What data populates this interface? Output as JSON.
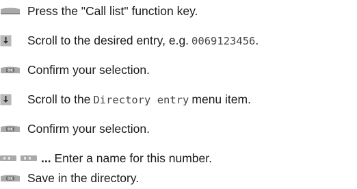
{
  "steps": [
    {
      "icon": "function-key-icon",
      "parts": [
        "Press the \"Call list\" function key."
      ]
    },
    {
      "icon": "scroll-down-icon",
      "parts": [
        "Scroll to the desired entry, e.g. ",
        "0069123456",
        "."
      ]
    },
    {
      "icon": "ok-key-icon",
      "parts": [
        "Confirm your selection."
      ]
    },
    {
      "icon": "scroll-down-icon",
      "parts": [
        "Scroll to the ",
        "Directory entry",
        " menu item."
      ]
    },
    {
      "icon": "ok-key-icon",
      "parts": [
        "Confirm your selection."
      ]
    },
    {
      "icon": "digit-keys-icon",
      "parts": [
        "...",
        " Enter a name for this number."
      ]
    },
    {
      "icon": "ok-key-icon",
      "parts": [
        "Save in the directory."
      ]
    }
  ],
  "colors": {
    "key_gray": "#9a9a9a",
    "key_light": "#cfcfcf",
    "scroll_dark": "#4a4a4a"
  }
}
